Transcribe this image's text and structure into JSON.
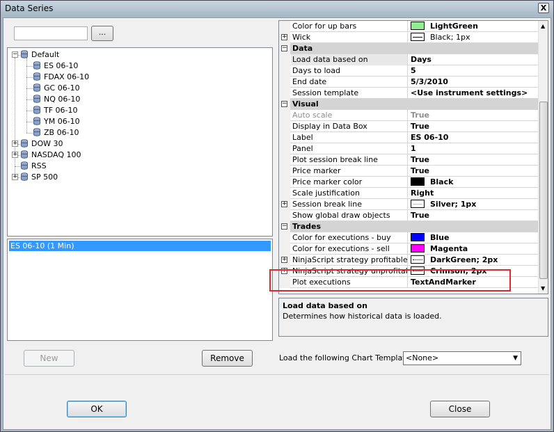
{
  "window": {
    "title": "Data Series",
    "close_glyph": "X"
  },
  "instrument_search": {
    "value": "",
    "browse_label": "..."
  },
  "tree": [
    {
      "label": "Default",
      "level": 0,
      "expanded": true
    },
    {
      "label": "ES 06-10",
      "level": 1
    },
    {
      "label": "FDAX 06-10",
      "level": 1
    },
    {
      "label": "GC 06-10",
      "level": 1
    },
    {
      "label": "NQ 06-10",
      "level": 1
    },
    {
      "label": "TF 06-10",
      "level": 1
    },
    {
      "label": "YM 06-10",
      "level": 1
    },
    {
      "label": "ZB 06-10",
      "level": 1
    },
    {
      "label": "DOW 30",
      "level": 0,
      "expander": "+"
    },
    {
      "label": "NASDAQ 100",
      "level": 0,
      "expander": "+"
    },
    {
      "label": "RSS",
      "level": 0
    },
    {
      "label": "SP 500",
      "level": 0,
      "expander": "+"
    }
  ],
  "series_list": {
    "items": [
      "ES 06-10 (1 Min)"
    ]
  },
  "buttons": {
    "new": "New",
    "remove": "Remove",
    "ok": "OK",
    "close": "Close"
  },
  "properties": {
    "rows": [
      {
        "kind": "prop",
        "name": "Color for up bars",
        "value": "LightGreen",
        "swatch": "#90ee90"
      },
      {
        "kind": "prop",
        "name": "Wick",
        "value": "Black; 1px",
        "pen": "solid",
        "expander": "+",
        "normal": true
      },
      {
        "kind": "cat",
        "name": "Data"
      },
      {
        "kind": "prop",
        "name": "Load data based on",
        "value": "Days",
        "selected": true
      },
      {
        "kind": "prop",
        "name": "Days to load",
        "value": "5"
      },
      {
        "kind": "prop",
        "name": "End date",
        "value": "5/3/2010"
      },
      {
        "kind": "prop",
        "name": "Session template",
        "value": "<Use instrument settings>"
      },
      {
        "kind": "cat",
        "name": "Visual"
      },
      {
        "kind": "prop",
        "name": "Auto scale",
        "value": "True",
        "gray": true
      },
      {
        "kind": "prop",
        "name": "Display in Data Box",
        "value": "True"
      },
      {
        "kind": "prop",
        "name": "Label",
        "value": "ES 06-10"
      },
      {
        "kind": "prop",
        "name": "Panel",
        "value": "1"
      },
      {
        "kind": "prop",
        "name": "Plot session break line",
        "value": "True"
      },
      {
        "kind": "prop",
        "name": "Price marker",
        "value": "True"
      },
      {
        "kind": "prop",
        "name": "Price marker color",
        "value": "Black",
        "swatch": "#000000"
      },
      {
        "kind": "prop",
        "name": "Scale justification",
        "value": "Right"
      },
      {
        "kind": "prop",
        "name": "Session break line",
        "value": "Silver; 1px",
        "pen": "silver",
        "expander": "+"
      },
      {
        "kind": "prop",
        "name": "Show global draw objects",
        "value": "True"
      },
      {
        "kind": "cat",
        "name": "Trades"
      },
      {
        "kind": "prop",
        "name": "Color for executions - buy",
        "value": "Blue",
        "swatch": "#0000ff"
      },
      {
        "kind": "prop",
        "name": "Color for executions - sell",
        "value": "Magenta",
        "swatch": "#ff00ff"
      },
      {
        "kind": "prop",
        "name": "NinjaScript strategy profitable trac",
        "value": "DarkGreen; 2px",
        "pen": "dotted",
        "expander": "+"
      },
      {
        "kind": "prop",
        "name": "NinjaScript strategy unprofitable tr",
        "value": "Crimson; 2px",
        "pen": "dotted",
        "expander": "+"
      },
      {
        "kind": "prop",
        "name": "Plot executions",
        "value": "TextAndMarker"
      }
    ]
  },
  "help": {
    "title": "Load data based on",
    "description": "Determines how historical data is loaded."
  },
  "chart_template": {
    "label": "Load the following Chart Template:",
    "selected": "<None>"
  },
  "colors": {
    "selection": "#3399ff",
    "highlight_box": "#e0282e"
  }
}
